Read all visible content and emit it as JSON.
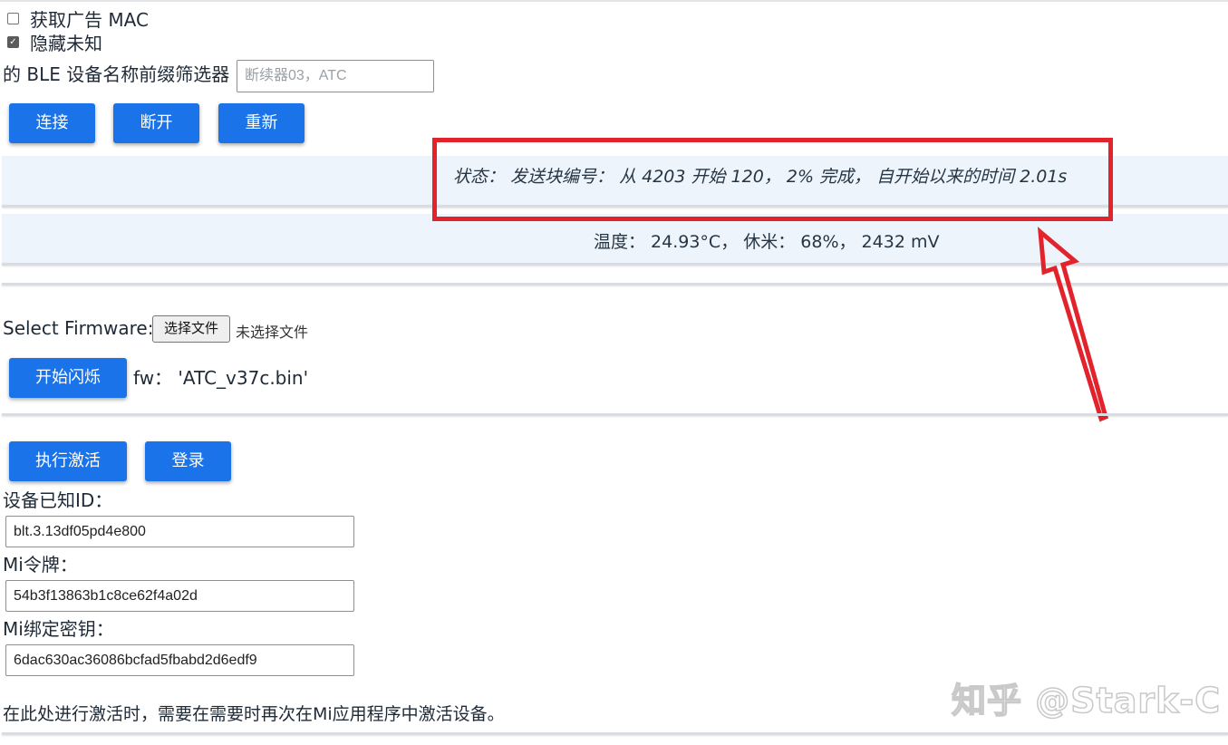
{
  "options": {
    "get_ad_mac_label": "获取广告 MAC",
    "get_ad_mac_checked": false,
    "hide_unknown_label": "隐藏未知",
    "hide_unknown_checked": true
  },
  "filter": {
    "label": "的 BLE 设备名称前缀筛选器",
    "placeholder": "断续器03，ATC"
  },
  "connection_buttons": {
    "connect": "连接",
    "disconnect": "断开",
    "reconnect": "重新"
  },
  "status": {
    "text": "状态：  发送块编号：  从 4203 开始 120，  2% 完成，  自开始以来的时间 2.01s"
  },
  "sensor": {
    "text": "温度：  24.93°C，  休米：  68%，  2432 mV"
  },
  "firmware": {
    "label": "Select Firmware:",
    "choose_file_button": "选择文件",
    "no_file_text": "未选择文件",
    "start_flash_button": "开始闪烁",
    "fw_text": "fw：  'ATC_v37c.bin'"
  },
  "activation": {
    "activate_button": "执行激活",
    "login_button": "登录",
    "device_id_label": "设备已知ID：",
    "device_id_value": "blt.3.13df05pd4e800",
    "mi_token_label": "Mi令牌：",
    "mi_token_value": "54b3f13863b1c8ce62f4a02d",
    "mi_bind_key_label": "Mi绑定密钥：",
    "mi_bind_key_value": "6dac630ac36086bcfad5fbabd2d6edf9",
    "note": "在此处进行激活时，需要在需要时再次在Mi应用程序中激活设备。"
  },
  "watermark": "知乎 @Stark-C",
  "colors": {
    "button_blue": "#1a73e8",
    "highlight_red": "#e3232b",
    "band_background": "#eef4fb"
  }
}
